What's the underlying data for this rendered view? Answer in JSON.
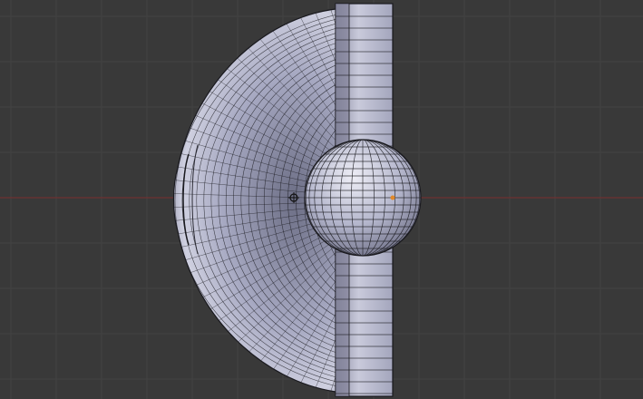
{
  "viewport": {
    "background_color": "#393939",
    "grid_color": "#424242",
    "x_axis_color": "#7a2f2f",
    "mesh_face_color": "#a7a9c2",
    "mesh_face_light_color": "#d8d9e8",
    "mesh_face_dark_color": "#6e6f86",
    "wire_color": "#1a1a1f",
    "selection_origin_color": "#e28a2a"
  },
  "objects": [
    {
      "name": "half-dome-mesh",
      "icon": "mesh-object-icon"
    },
    {
      "name": "side-slab-mesh",
      "icon": "mesh-object-icon"
    },
    {
      "name": "uv-sphere-mesh",
      "icon": "mesh-object-icon"
    }
  ],
  "markers": {
    "origin_icon": "origin-dot-icon",
    "cursor_icon": "3d-cursor-icon"
  }
}
